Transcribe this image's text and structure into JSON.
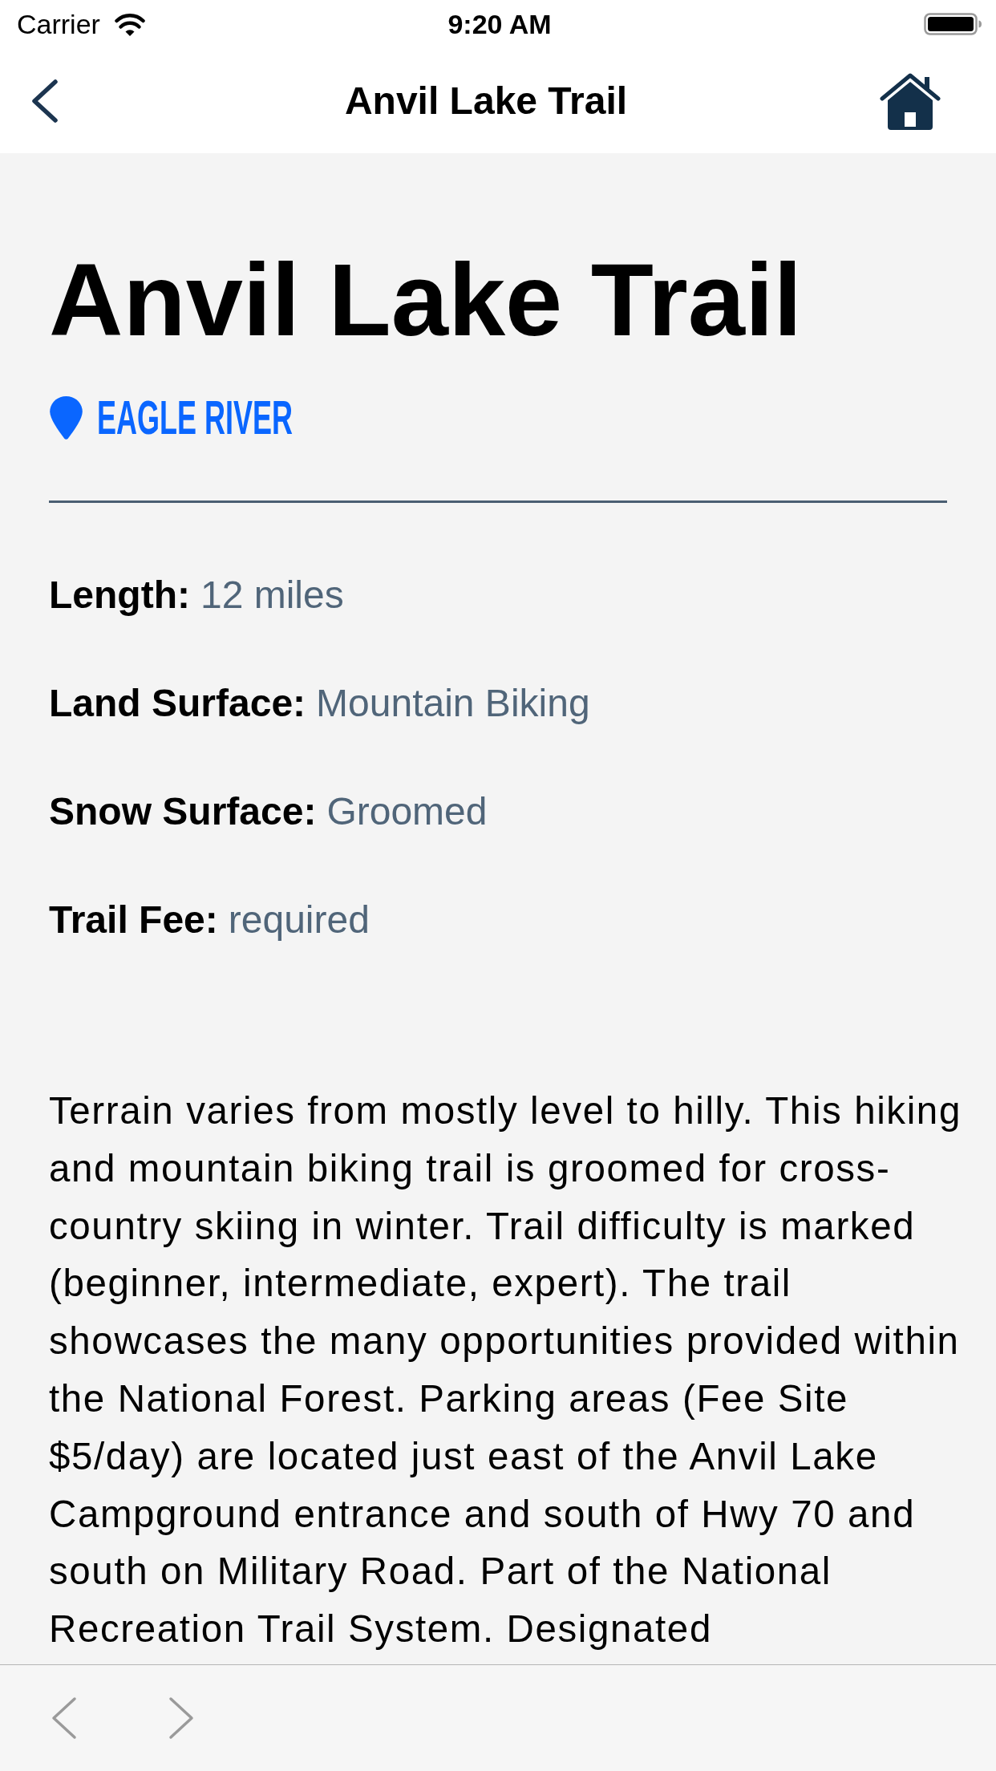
{
  "status_bar": {
    "carrier": "Carrier",
    "time": "9:20 AM"
  },
  "nav_bar": {
    "title": "Anvil Lake Trail"
  },
  "trail": {
    "name": "Anvil Lake Trail",
    "location": "EAGLE RIVER"
  },
  "details": [
    {
      "label": "Length:",
      "value": "12 miles"
    },
    {
      "label": "Land Surface:",
      "value": "Mountain Biking"
    },
    {
      "label": "Snow Surface:",
      "value": "Groomed"
    },
    {
      "label": "Trail Fee:",
      "value": "required"
    }
  ],
  "description": "Terrain varies from mostly level to hilly. This hiking and mountain biking trail is groomed for cross-country skiing in winter. Trail difficulty is marked (beginner, intermediate, expert). The trail showcases the many opportunities provided within the National Forest. Parking areas (Fee Site $5/day) are located just east of the Anvil Lake Campground entrance and south of Hwy 70 and south on Military Road. Part of the National Recreation Trail System. Designated"
}
